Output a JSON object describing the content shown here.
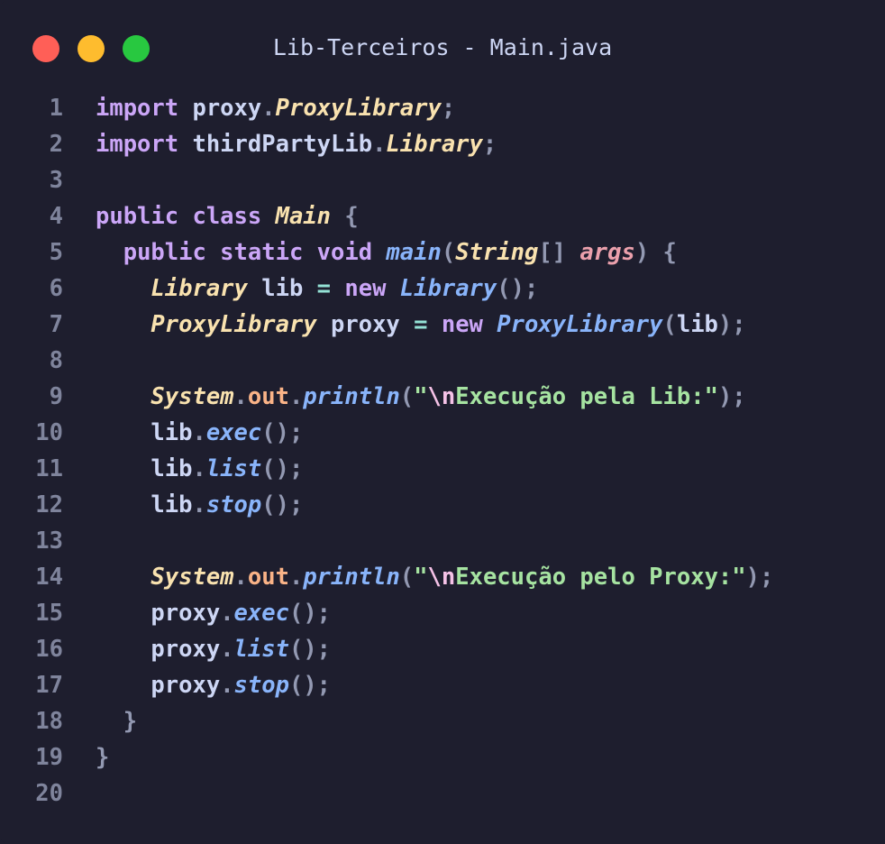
{
  "window": {
    "title": "Lib-Terceiros - Main.java",
    "buttons": [
      {
        "name": "close",
        "color": "#ff5f57"
      },
      {
        "name": "minimize",
        "color": "#febc2e"
      },
      {
        "name": "maximize",
        "color": "#28c840"
      }
    ]
  },
  "colors": {
    "background": "#1e1e2e",
    "keyword": "#cba6f7",
    "type": "#f9e2af",
    "function": "#89b4fa",
    "string": "#a6e3a1",
    "field": "#fab387",
    "param": "#eba0ac",
    "operator": "#94e2d5",
    "line_number": "#7f849c"
  },
  "code": {
    "lines": [
      {
        "n": "1",
        "indent": "",
        "tokens": [
          [
            "kw",
            "import"
          ],
          [
            "id",
            " proxy"
          ],
          [
            "punct",
            "."
          ],
          [
            "type-i",
            "ProxyLibrary"
          ],
          [
            "punct",
            ";"
          ]
        ]
      },
      {
        "n": "2",
        "indent": "",
        "tokens": [
          [
            "kw",
            "import"
          ],
          [
            "id",
            " thirdPartyLib"
          ],
          [
            "punct",
            "."
          ],
          [
            "type-i",
            "Library"
          ],
          [
            "punct",
            ";"
          ]
        ]
      },
      {
        "n": "3",
        "indent": "",
        "tokens": []
      },
      {
        "n": "4",
        "indent": "",
        "tokens": [
          [
            "kw",
            "public class "
          ],
          [
            "type-i",
            "Main"
          ],
          [
            "punct",
            " {"
          ]
        ]
      },
      {
        "n": "5",
        "indent": "  ",
        "tokens": [
          [
            "kw",
            "public static void "
          ],
          [
            "fn",
            "main"
          ],
          [
            "punct",
            "("
          ],
          [
            "type-i",
            "String"
          ],
          [
            "punct",
            "[] "
          ],
          [
            "param",
            "args"
          ],
          [
            "punct",
            ") {"
          ]
        ]
      },
      {
        "n": "6",
        "indent": "    ",
        "tokens": [
          [
            "type-i",
            "Library"
          ],
          [
            "id",
            " lib "
          ],
          [
            "op",
            "="
          ],
          [
            "kw",
            " new "
          ],
          [
            "fn",
            "Library"
          ],
          [
            "punct",
            "();"
          ]
        ]
      },
      {
        "n": "7",
        "indent": "    ",
        "tokens": [
          [
            "type-i",
            "ProxyLibrary"
          ],
          [
            "id",
            " proxy "
          ],
          [
            "op",
            "="
          ],
          [
            "kw",
            " new "
          ],
          [
            "fn",
            "ProxyLibrary"
          ],
          [
            "punct",
            "("
          ],
          [
            "id",
            "lib"
          ],
          [
            "punct",
            ");"
          ]
        ]
      },
      {
        "n": "8",
        "indent": "",
        "tokens": []
      },
      {
        "n": "9",
        "indent": "    ",
        "tokens": [
          [
            "type-i",
            "System"
          ],
          [
            "punct",
            "."
          ],
          [
            "field",
            "out"
          ],
          [
            "punct",
            "."
          ],
          [
            "fn",
            "println"
          ],
          [
            "punct",
            "("
          ],
          [
            "str",
            "\""
          ],
          [
            "esc",
            "\\n"
          ],
          [
            "str",
            "Execução pela Lib:\""
          ],
          [
            "punct",
            ");"
          ]
        ]
      },
      {
        "n": "10",
        "indent": "    ",
        "tokens": [
          [
            "id",
            "lib"
          ],
          [
            "punct",
            "."
          ],
          [
            "fn",
            "exec"
          ],
          [
            "punct",
            "();"
          ]
        ]
      },
      {
        "n": "11",
        "indent": "    ",
        "tokens": [
          [
            "id",
            "lib"
          ],
          [
            "punct",
            "."
          ],
          [
            "fn",
            "list"
          ],
          [
            "punct",
            "();"
          ]
        ]
      },
      {
        "n": "12",
        "indent": "    ",
        "tokens": [
          [
            "id",
            "lib"
          ],
          [
            "punct",
            "."
          ],
          [
            "fn",
            "stop"
          ],
          [
            "punct",
            "();"
          ]
        ]
      },
      {
        "n": "13",
        "indent": "",
        "tokens": []
      },
      {
        "n": "14",
        "indent": "    ",
        "tokens": [
          [
            "type-i",
            "System"
          ],
          [
            "punct",
            "."
          ],
          [
            "field",
            "out"
          ],
          [
            "punct",
            "."
          ],
          [
            "fn",
            "println"
          ],
          [
            "punct",
            "("
          ],
          [
            "str",
            "\""
          ],
          [
            "esc",
            "\\n"
          ],
          [
            "str",
            "Execução pelo Proxy:\""
          ],
          [
            "punct",
            ");"
          ]
        ]
      },
      {
        "n": "15",
        "indent": "    ",
        "tokens": [
          [
            "id",
            "proxy"
          ],
          [
            "punct",
            "."
          ],
          [
            "fn",
            "exec"
          ],
          [
            "punct",
            "();"
          ]
        ]
      },
      {
        "n": "16",
        "indent": "    ",
        "tokens": [
          [
            "id",
            "proxy"
          ],
          [
            "punct",
            "."
          ],
          [
            "fn",
            "list"
          ],
          [
            "punct",
            "();"
          ]
        ]
      },
      {
        "n": "17",
        "indent": "    ",
        "tokens": [
          [
            "id",
            "proxy"
          ],
          [
            "punct",
            "."
          ],
          [
            "fn",
            "stop"
          ],
          [
            "punct",
            "();"
          ]
        ]
      },
      {
        "n": "18",
        "indent": "  ",
        "tokens": [
          [
            "punct",
            "}"
          ]
        ]
      },
      {
        "n": "19",
        "indent": "",
        "tokens": [
          [
            "punct",
            "}"
          ]
        ]
      },
      {
        "n": "20",
        "indent": "",
        "tokens": []
      }
    ]
  }
}
